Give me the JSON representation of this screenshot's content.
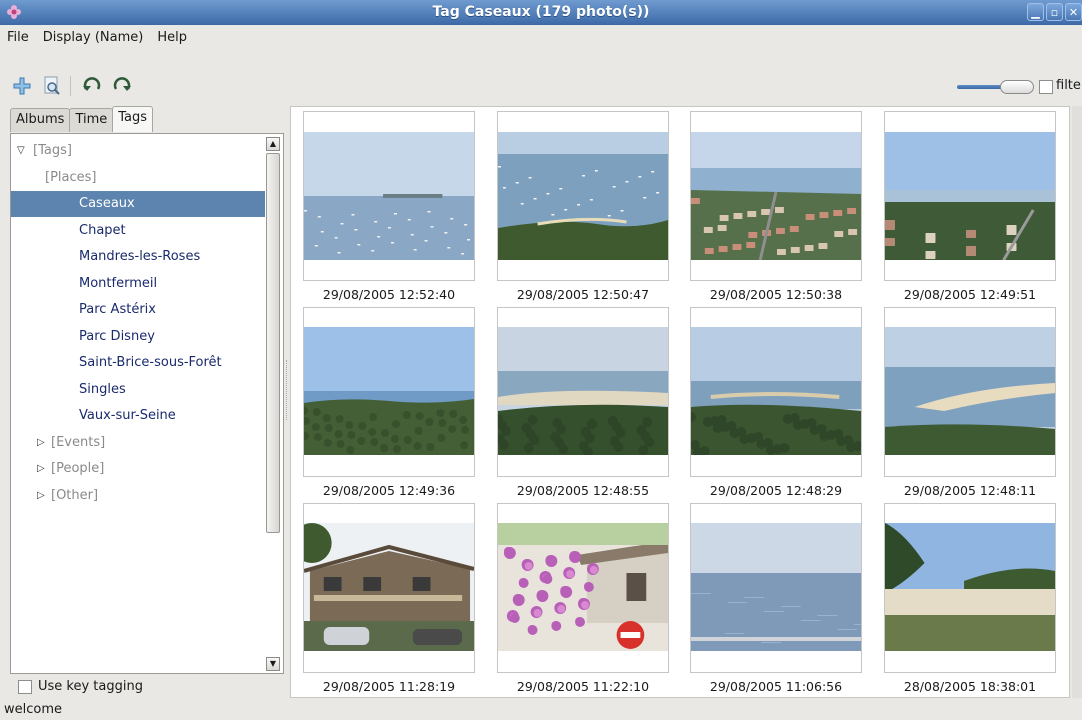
{
  "window": {
    "title": "Tag Caseaux (179 photo(s))",
    "icon": "flower-icon",
    "buttons": [
      "minimize-icon",
      "maximize-icon",
      "close-icon"
    ]
  },
  "menu": {
    "items": [
      "File",
      "Display (Name)",
      "Help"
    ]
  },
  "toolbar": {
    "buttons": [
      "add-icon",
      "search-photos-icon",
      "rotate-left-icon",
      "rotate-right-icon"
    ],
    "zoom_level": 0.75,
    "filter_label": "filte",
    "filter_checked": false
  },
  "tabs": {
    "items": [
      "Albums",
      "Time",
      "Tags"
    ],
    "active": "Tags"
  },
  "tree": {
    "items": [
      {
        "label": "[Tags]",
        "level": 0,
        "expander": "expanded",
        "style": "category"
      },
      {
        "label": "[Places]",
        "level": 1,
        "expander": "none",
        "style": "category"
      },
      {
        "label": "Caseaux",
        "level": 2,
        "expander": "none",
        "style": "place",
        "selected": true
      },
      {
        "label": "Chapet",
        "level": 2,
        "expander": "none",
        "style": "place"
      },
      {
        "label": "Mandres-les-Roses",
        "level": 2,
        "expander": "none",
        "style": "place"
      },
      {
        "label": "Montfermeil",
        "level": 2,
        "expander": "none",
        "style": "place"
      },
      {
        "label": "Parc Astérix",
        "level": 2,
        "expander": "none",
        "style": "place"
      },
      {
        "label": "Parc Disney",
        "level": 2,
        "expander": "none",
        "style": "place"
      },
      {
        "label": "Saint-Brice-sous-Forêt",
        "level": 2,
        "expander": "none",
        "style": "place"
      },
      {
        "label": "Singles",
        "level": 2,
        "expander": "none",
        "style": "place"
      },
      {
        "label": "Vaux-sur-Seine",
        "level": 2,
        "expander": "none",
        "style": "place"
      },
      {
        "label": "[Events]",
        "level": 1,
        "expander": "collapsed",
        "style": "category"
      },
      {
        "label": "[People]",
        "level": 1,
        "expander": "collapsed",
        "style": "category"
      },
      {
        "label": "[Other]",
        "level": 1,
        "expander": "collapsed",
        "style": "category"
      }
    ]
  },
  "key_tagging": {
    "label": "Use key tagging",
    "checked": false
  },
  "photos": [
    {
      "date": "29/08/2005 12:52:40",
      "scene": "bay-sailboats"
    },
    {
      "date": "29/08/2005 12:50:47",
      "scene": "bay-forest-shore"
    },
    {
      "date": "29/08/2005 12:50:38",
      "scene": "village-aerial"
    },
    {
      "date": "29/08/2005 12:49:51",
      "scene": "town-forest-aerial"
    },
    {
      "date": "29/08/2005 12:49:36",
      "scene": "forest-horizon"
    },
    {
      "date": "29/08/2005 12:48:55",
      "scene": "forest-lagoon"
    },
    {
      "date": "29/08/2005 12:48:29",
      "scene": "forest-bay"
    },
    {
      "date": "29/08/2005 12:48:11",
      "scene": "sandbank-bay"
    },
    {
      "date": "29/08/2005 11:28:19",
      "scene": "wooden-house"
    },
    {
      "date": "29/08/2005 11:22:10",
      "scene": "bougainvillea-house"
    },
    {
      "date": "29/08/2005 11:06:56",
      "scene": "calm-sea"
    },
    {
      "date": "28/08/2005 18:38:01",
      "scene": "beach-trees"
    }
  ],
  "status": {
    "text": "welcome"
  },
  "colors": {
    "titlebar": "#4a78b4",
    "selection": "#5d84ae",
    "place_text": "#1a2a6c",
    "category_text": "#8a8a8a"
  }
}
